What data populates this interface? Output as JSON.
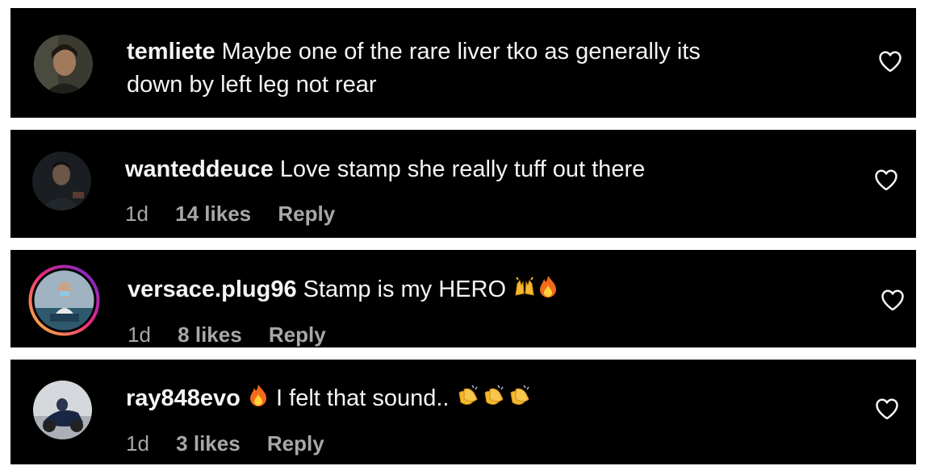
{
  "colors": {
    "card_background": "#000000",
    "text_primary": "#f5f5f5",
    "text_secondary": "#a8a8a8",
    "story_ring_gradient": [
      "#f9ce34",
      "#ee2a7b",
      "#6228d7"
    ]
  },
  "comments": [
    {
      "username": "temliete",
      "text_line1": "Maybe one of the rare liver tko as generally its",
      "text_line2": "down by left leg not rear",
      "like_icon": "heart-outline-icon"
    },
    {
      "username": "wanteddeuce",
      "text": "Love stamp she really tuff out there",
      "date": "1d",
      "likes": "14 likes",
      "reply": "Reply",
      "like_icon": "heart-outline-icon"
    },
    {
      "username": "versace.plug96",
      "text": "Stamp is my HERO",
      "emojis": [
        "raised-hands-emoji",
        "fire-emoji"
      ],
      "date": "1d",
      "likes": "8 likes",
      "reply": "Reply",
      "has_story_ring": true,
      "like_icon": "heart-outline-icon"
    },
    {
      "username": "ray848evo",
      "text": "I felt that sound..",
      "emojis": [
        "fire-emoji",
        "clapping-hands-emoji",
        "clapping-hands-emoji",
        "clapping-hands-emoji"
      ],
      "date": "1d",
      "likes": "3 likes",
      "reply": "Reply",
      "like_icon": "heart-outline-icon"
    }
  ]
}
